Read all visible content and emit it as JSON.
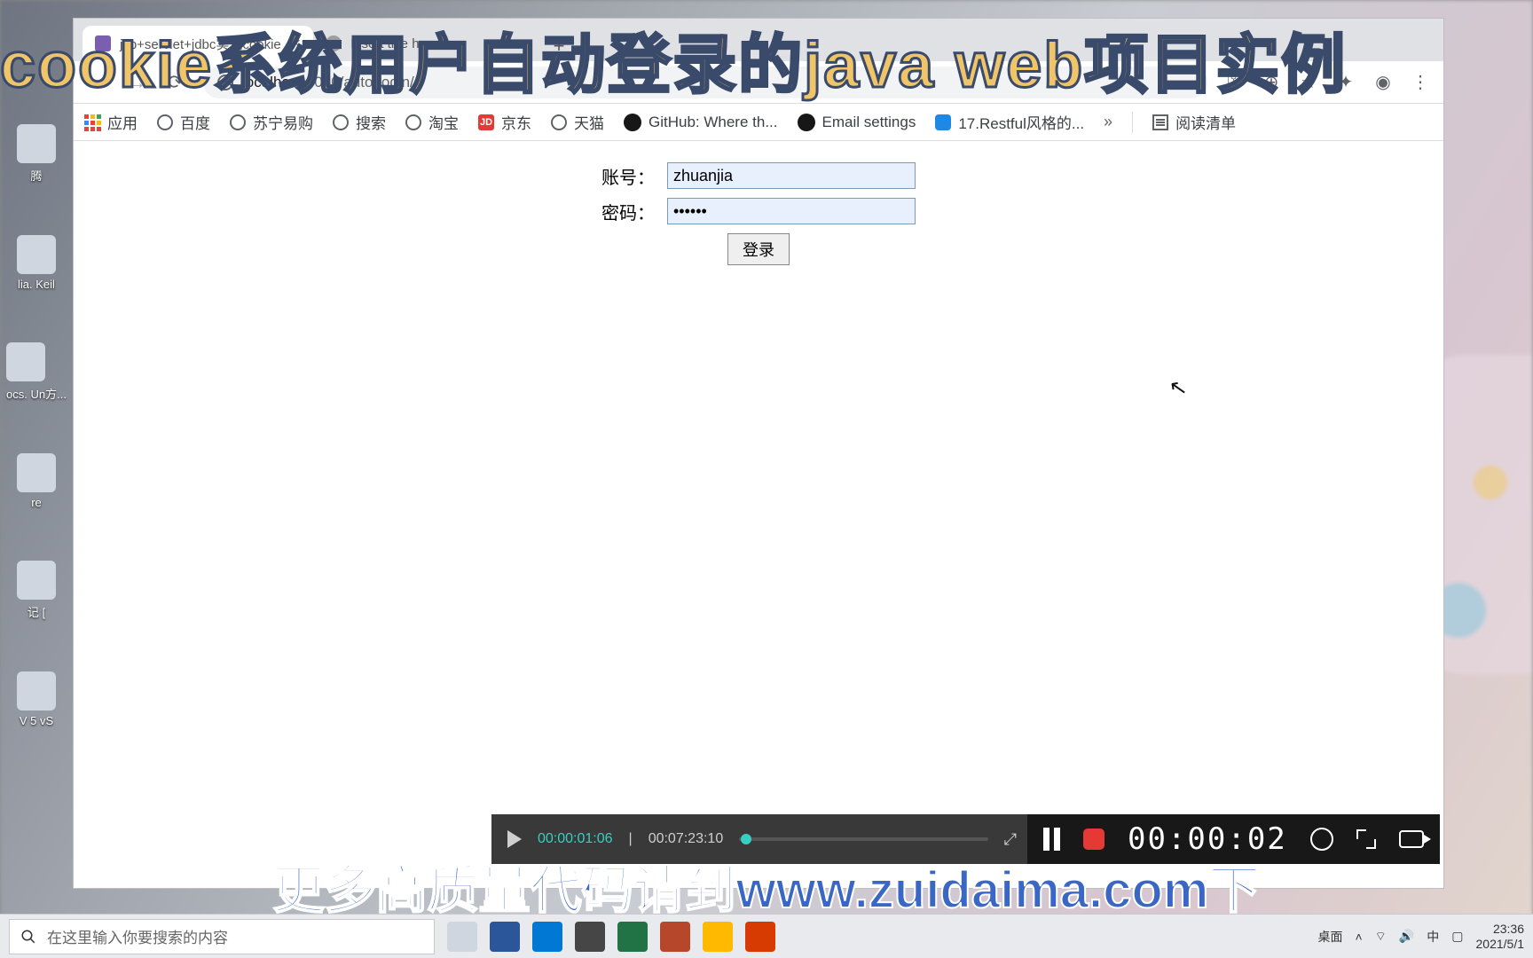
{
  "overlay": {
    "title": "cookie系统用户自动登录的java web项目实例",
    "footer": "更多高质量代码请到www.zuidaima.com下"
  },
  "desktop_icons": [
    "腾",
    "",
    "lia.  Keil",
    "ocs.  Un方...",
    "re",
    "记    [",
    "V  5 vS"
  ],
  "browser": {
    "tabs": [
      {
        "title": "jsp+servlet+jdbc实现cookie",
        "active": true
      },
      {
        "title": "Insert title here",
        "active": false
      }
    ],
    "url_host": "localhost",
    "url_rest": ":8080/autoLogin/",
    "bookmarks": [
      "应用",
      "百度",
      "苏宁易购",
      "搜索",
      "淘宝",
      "京东",
      "天猫",
      "GitHub: Where th...",
      "Email settings",
      "17.Restful风格的..."
    ],
    "bookmarks_more": "»",
    "reading_list": "阅读清单"
  },
  "form": {
    "account_label": "账号：",
    "account_value": "zhuanjia",
    "password_label": "密码：",
    "password_value": "••••••",
    "submit_label": "登录"
  },
  "player": {
    "current": "00:00:01:06",
    "total": "00:07:23:10"
  },
  "recorder": {
    "elapsed": "00:00:02"
  },
  "taskbar": {
    "search_placeholder": "在这里输入你要搜索的内容",
    "desktop_label": "桌面",
    "time": "23:36",
    "date": "2021/5/1"
  }
}
